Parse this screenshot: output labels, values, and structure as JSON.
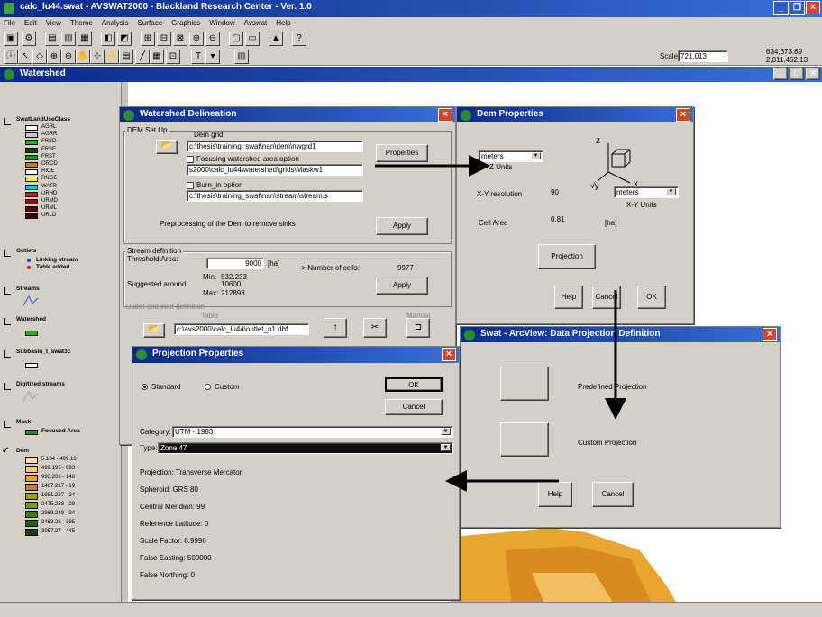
{
  "app": {
    "title": "calc_lu44.swat - AVSWAT2000 - Blackland Research Center - Ver. 1.0",
    "menu": [
      "File",
      "Edit",
      "View",
      "Theme",
      "Analysis",
      "Surface",
      "Graphics",
      "Window",
      "Avswat",
      "Help"
    ],
    "scale_label": "Scale 1:",
    "scale_value": "721,013",
    "coords": "634,673.89\n2,011,452.13"
  },
  "watershed_window": {
    "title": "Watershed",
    "legend": {
      "landuse_title": "SwatLandUseClass",
      "landuse_items": [
        {
          "label": "AGRL",
          "color": "#ffffff"
        },
        {
          "label": "AGRR",
          "color": "#c8c8c8"
        },
        {
          "label": "FRSD",
          "color": "#00c800"
        },
        {
          "label": "FRSE",
          "color": "#005000"
        },
        {
          "label": "FRST",
          "color": "#00a000"
        },
        {
          "label": "ORCD",
          "color": "#c88000"
        },
        {
          "label": "RICE",
          "color": "#ffffff"
        },
        {
          "label": "RNGE",
          "color": "#ffff00"
        },
        {
          "label": "WATR",
          "color": "#00c8ff"
        },
        {
          "label": "URHD",
          "color": "#ff0000"
        },
        {
          "label": "URMD",
          "color": "#a00000"
        },
        {
          "label": "URML",
          "color": "#600000"
        },
        {
          "label": "URLD",
          "color": "#400000"
        }
      ],
      "outlets_title": "Outlets",
      "outlets_items": [
        "Linking stream",
        "Table added"
      ],
      "streams_title": "Streams",
      "watershed_title": "Watershed",
      "subbasin_title": "Subbasin_t_swat3c",
      "digitized_title": "Digitized streams",
      "mask_title": "Mask",
      "mask_item": "Focused Area",
      "dem_title": "Dem",
      "dem_items": [
        {
          "label": "5.104 - 499.16",
          "color": "#ffe0a0"
        },
        {
          "label": "499.195 - 993",
          "color": "#ffc860"
        },
        {
          "label": "993.206 - 148",
          "color": "#f0a020"
        },
        {
          "label": "1487.217 - 19",
          "color": "#d08000"
        },
        {
          "label": "1981.227 - 24",
          "color": "#a0a000"
        },
        {
          "label": "2475.238 - 29",
          "color": "#70a000"
        },
        {
          "label": "2969.249 - 34",
          "color": "#408000"
        },
        {
          "label": "3463.26 - 395",
          "color": "#206000"
        },
        {
          "label": "3957.27 - 445",
          "color": "#104000"
        }
      ]
    }
  },
  "watershed_delineation": {
    "title": "Watershed Delineation",
    "dem_setup_label": "DEM Set Up",
    "dem_grid_label": "Dem grid",
    "dem_grid_path": "c:\\thesis\\training_swat\\nan\\dem\\nwgrd1",
    "properties_btn": "Properties",
    "focusing_label": "Focusing watershed  area option",
    "focusing_path": "s2000\\calc_lu44\\watershed\\grids\\Maskw1",
    "burnin_label": "Burn_in option",
    "burnin_path": "c:\\thesis\\training_swat\\nan\\stream\\stream.s",
    "preprocess_label": "Preprocessing of the Dem to remove sinks",
    "apply_btn": "Apply",
    "stream_def_label": "Stream definition",
    "threshold_label": "Threshold Area:",
    "threshold_value": "9000",
    "threshold_unit": "[ha]",
    "cells_label": "--> Number of cells:",
    "cells_value": "9977",
    "min_label": "Min:",
    "min_value": "532.233",
    "suggested_label": "Suggested around:",
    "suggested_value": "10600",
    "max_label": "Max:",
    "max_value": "212893",
    "apply2_btn": "Apply",
    "outlet_label": "Outlet and inlet definition",
    "table_label": "Table",
    "manual_label": "Manual",
    "outlet_path": "c:\\avs2000\\calc_lu44\\outlet_n1.dbf"
  },
  "dem_properties": {
    "title": "Dem Properties",
    "z_units": "meters",
    "z_units_label": "Z Units",
    "xy_res_label": "X-Y resolution",
    "xy_res_value": "90",
    "xy_units": "meters",
    "xy_units_label": "X-Y Units",
    "cell_area_label": "Cell Area",
    "cell_area_value": "0.81",
    "cell_area_unit": "[ha]",
    "projection_btn": "Projection",
    "help_btn": "Help",
    "cancel_btn": "Cancel",
    "ok_btn": "OK"
  },
  "data_projection": {
    "title": "Swat - ArcView: Data Projection Definition",
    "predefined_label": "Predefined Projection",
    "custom_label": "Custom Projection",
    "help_btn": "Help",
    "cancel_btn": "Cancel"
  },
  "projection_properties": {
    "title": "Projection Properties",
    "standard_label": "Standard",
    "custom_label": "Custom",
    "ok_btn": "OK",
    "cancel_btn": "Cancel",
    "category_label": "Category:",
    "category_value": "UTM - 1983",
    "type_label": "Type:",
    "type_value": "Zone 47",
    "details": [
      "Projection:  Transverse Mercator",
      "Spheroid:  GRS 80",
      "Central Meridian: 99",
      "Reference Latitude: 0",
      "Scale Factor: 0.9996",
      "False Easting: 500000",
      "False Northing: 0"
    ]
  }
}
